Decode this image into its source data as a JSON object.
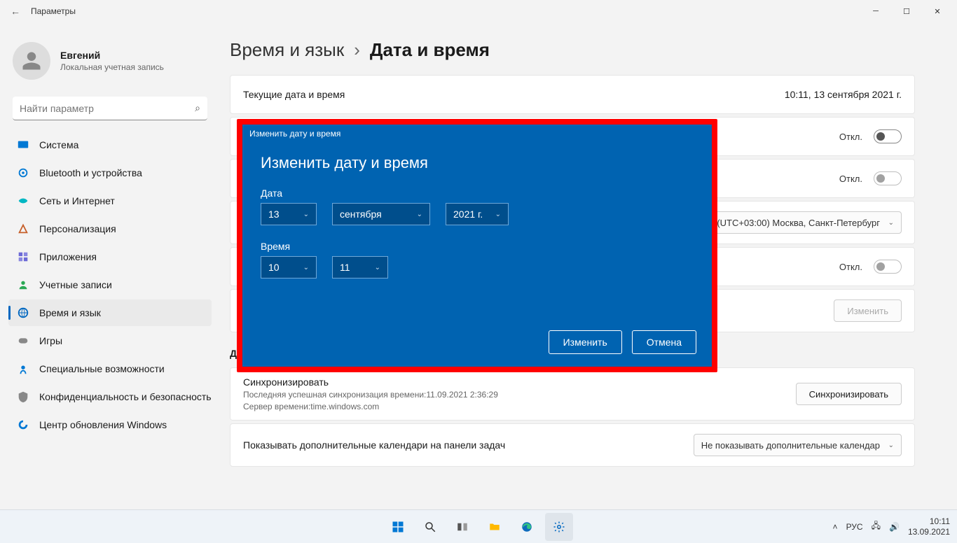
{
  "titlebar": {
    "title": "Параметры"
  },
  "user": {
    "name": "Евгений",
    "sub": "Локальная учетная запись"
  },
  "search": {
    "placeholder": "Найти параметр"
  },
  "nav": [
    {
      "label": "Система",
      "color": "#0078d4"
    },
    {
      "label": "Bluetooth и устройства",
      "color": "#0078d4"
    },
    {
      "label": "Сеть и Интернет",
      "color": "#00b7c3"
    },
    {
      "label": "Персонализация",
      "color": "#c65e28"
    },
    {
      "label": "Приложения",
      "color": "#6b69d6"
    },
    {
      "label": "Учетные записи",
      "color": "#2aa854"
    },
    {
      "label": "Время и язык",
      "color": "#0067c0"
    },
    {
      "label": "Игры",
      "color": "#888"
    },
    {
      "label": "Специальные возможности",
      "color": "#0078d4"
    },
    {
      "label": "Конфиденциальность и безопасность",
      "color": "#888"
    },
    {
      "label": "Центр обновления Windows",
      "color": "#0078d4"
    }
  ],
  "active_nav": 6,
  "breadcrumb": {
    "c1": "Время и язык",
    "c2": "Дата и время"
  },
  "cards": {
    "current": {
      "label": "Текущие дата и время",
      "value": "10:11, 13 сентября 2021 г."
    },
    "row1_state": "Откл.",
    "row2_state": "Откл.",
    "tz_value": "(UTC+03:00) Москва, Санкт-Петербург",
    "row3_state": "Откл.",
    "change_btn": "Изменить"
  },
  "section": "Дополнительные параметры",
  "sync": {
    "title": "Синхронизировать",
    "line1": "Последняя успешная синхронизация времени:11.09.2021 2:36:29",
    "line2": "Сервер времени:time.windows.com",
    "btn": "Синхронизировать"
  },
  "extra_cal": {
    "label": "Показывать дополнительные календари на панели задач",
    "value": "Не показывать дополнительные календар"
  },
  "modal": {
    "title_sm": "Изменить дату и время",
    "title": "Изменить дату и время",
    "date_label": "Дата",
    "time_label": "Время",
    "day": "13",
    "month": "сентября",
    "year": "2021 г.",
    "hour": "10",
    "minute": "11",
    "ok": "Изменить",
    "cancel": "Отмена"
  },
  "tray": {
    "lang": "РУС",
    "time": "10:11",
    "date": "13.09.2021"
  }
}
